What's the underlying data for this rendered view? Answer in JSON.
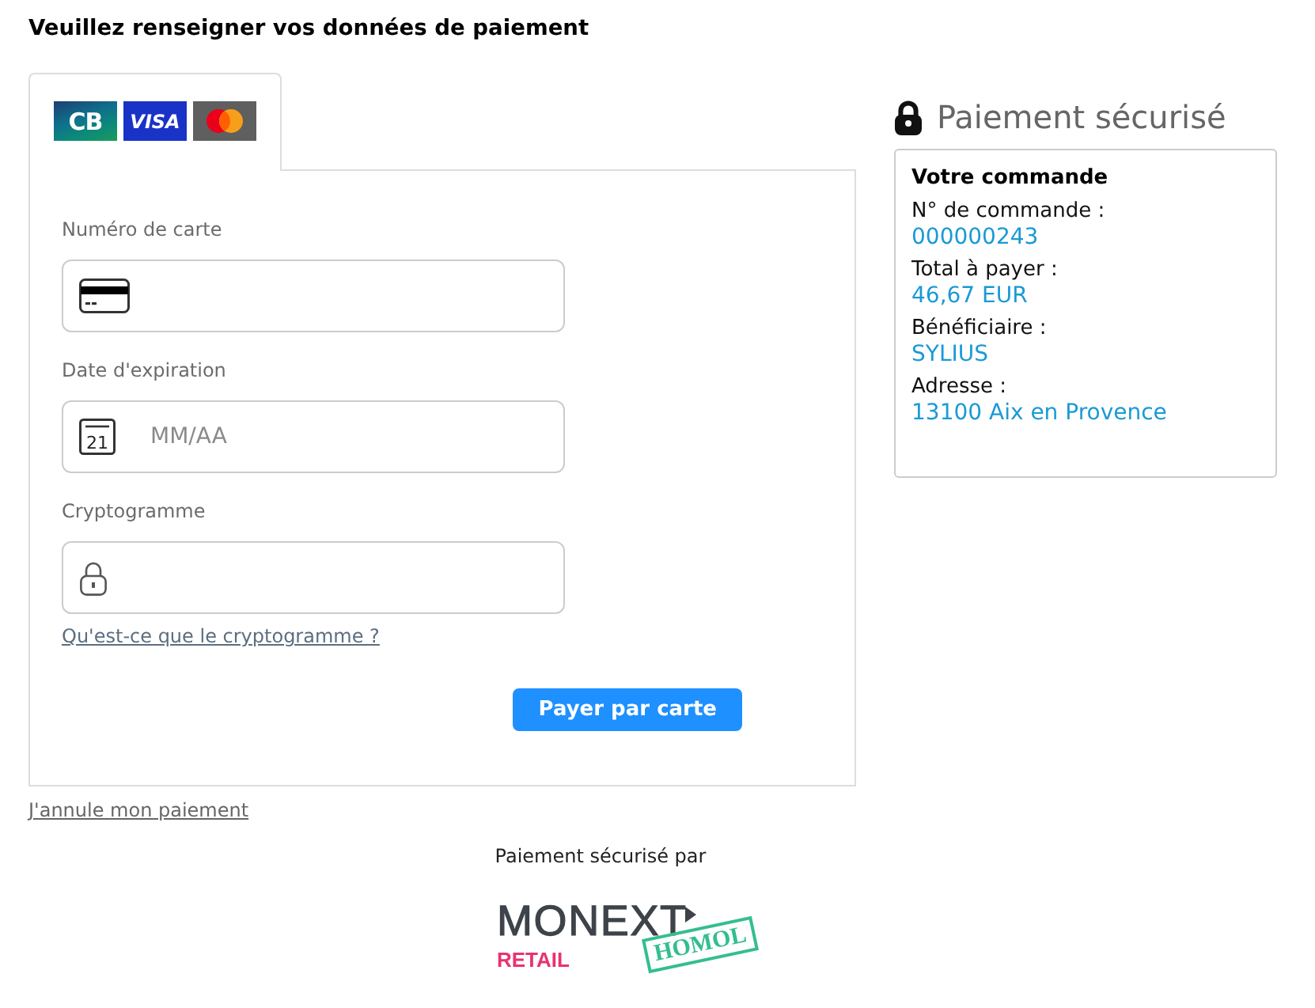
{
  "heading": "Veuillez renseigner vos données de paiement",
  "payment_tab": {
    "selected": true,
    "brands": [
      {
        "kind": "cb",
        "label": "CB"
      },
      {
        "kind": "visa",
        "label": "VISA"
      },
      {
        "kind": "mastercard"
      }
    ]
  },
  "fields": [
    {
      "kind": "card_number",
      "label": "Numéro de carte"
    },
    {
      "kind": "expiry",
      "label": "Date d'expiration",
      "placeholder": "MM/AA",
      "icon_label": "21"
    },
    {
      "kind": "cvv",
      "label": "Cryptogramme"
    }
  ],
  "help_link": "Qu'est-ce que le cryptogramme ?",
  "submit_button": "Payer par carte",
  "cancel_link": "J'annule mon paiement",
  "secure_title": "Paiement sécurisé",
  "order_summary": {
    "title": "Votre commande",
    "items": [
      {
        "label": "N° de commande :",
        "value": "000000243"
      },
      {
        "label": "Total à payer :",
        "value": "46,67 EUR"
      },
      {
        "label": "Bénéficiaire :",
        "value": "SYLIUS"
      },
      {
        "label": "Adresse :",
        "value": "13100 Aix en Provence"
      }
    ]
  },
  "footer": {
    "caption": "Paiement sécurisé par",
    "logo": {
      "wordmark": "MONEXT",
      "subtitle": "RETAIL",
      "stamp": "HOMOL"
    }
  }
}
